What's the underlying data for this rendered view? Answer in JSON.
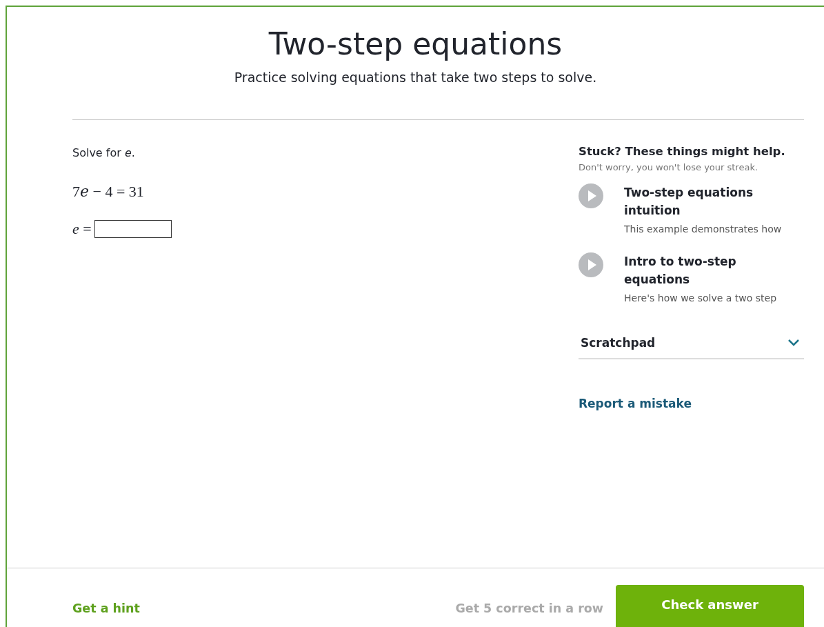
{
  "title": "Two-step equations",
  "subtitle": "Practice solving equations that take two steps to solve.",
  "problem": {
    "prompt": "Solve for *e*.",
    "equation": {
      "coefficient": "7",
      "variable": "e",
      "rest": " − 4 = 31"
    },
    "answer_label": "*e* ="
  },
  "help": {
    "heading": "Stuck? These things might help.",
    "note": "Don't worry, you won't lose your streak.",
    "videos": [
      {
        "title": "Two-step equations intuition",
        "description": "This example demonstrates how"
      },
      {
        "title": "Intro to two-step equations",
        "description": "Here's how we solve a two step"
      }
    ],
    "scratchpad": {
      "label": "Scratchpad",
      "expanded": false
    },
    "report_link": "Report a mistake"
  },
  "footer": {
    "hint": "Get a hint",
    "streak": "Get 5 correct in a row",
    "check_button": "Check answer"
  }
}
